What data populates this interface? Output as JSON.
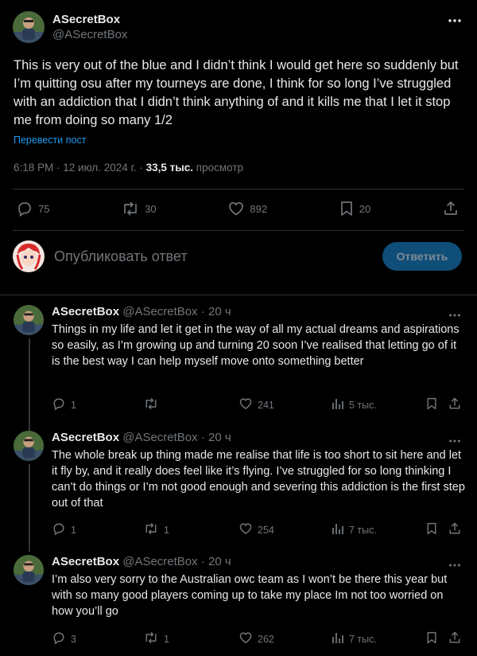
{
  "colors": {
    "background": "#000000",
    "text": "#e7e9ea",
    "muted": "#71767b",
    "link": "#1d9bf0",
    "reply_button": "#0f4e78",
    "divider": "#2f3336"
  },
  "main_tweet": {
    "display_name": "ASecretBox",
    "handle": "@ASecretBox",
    "text": "This is very out of the blue and I didn’t think I would get here so suddenly but I’m quitting osu after my tourneys are done, I think for so long I’ve struggled with an addiction that I didn’t think anything of and it kills me that I let it stop me from doing so many 1/2",
    "translate_link": "Перевести пост",
    "timestamp": "6:18 PM · 12 июл. 2024 г. · ",
    "views_count": "33,5 тыс.",
    "views_label": " просмотр",
    "replies": "75",
    "reposts": "30",
    "likes": "892",
    "bookmarks": "20",
    "icons": [
      "reply-icon",
      "repost-icon",
      "like-icon",
      "bookmark-icon",
      "share-icon",
      "more-icon"
    ]
  },
  "reply_composer": {
    "placeholder": "Опубликовать ответ",
    "button_label": "Ответить"
  },
  "thread": [
    {
      "display_name": "ASecretBox",
      "handle_time": " @ASecretBox · 20 ч",
      "text": "Things in my life and let it get in the way of all my actual dreams and aspirations so easily, as I’m growing up and turning 20 soon I’ve realised that letting go of it is the best way I can help myself move onto something better",
      "replies": "1",
      "reposts": "",
      "likes": "241",
      "views": "5 тыс."
    },
    {
      "display_name": "ASecretBox",
      "handle_time": " @ASecretBox · 20 ч",
      "text": "The whole break up thing made me realise that life is too short to sit here and let it fly by, and it really does feel like it’s flying. I’ve struggled for so long thinking I can’t do things or I’m not good enough and severing this addiction is the first step out of that",
      "replies": "1",
      "reposts": "1",
      "likes": "254",
      "views": "7 тыс."
    },
    {
      "display_name": "ASecretBox",
      "handle_time": " @ASecretBox · 20 ч",
      "text": "I’m also very sorry to the Australian owc team as I won’t be there this year but with so many good players coming up to take my place Im not too worried on how you’ll go",
      "replies": "3",
      "reposts": "1",
      "likes": "262",
      "views": "7 тыс."
    }
  ]
}
